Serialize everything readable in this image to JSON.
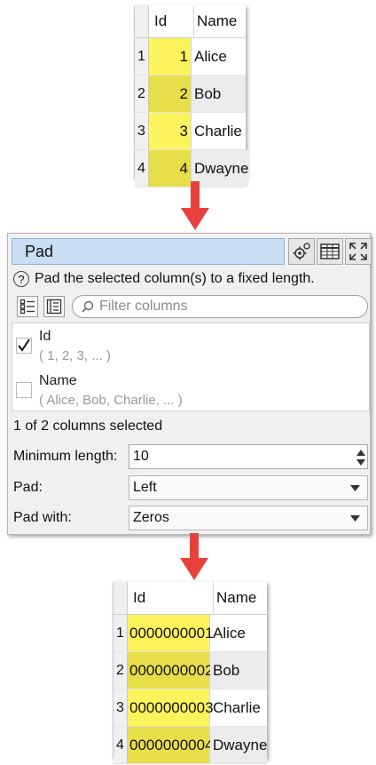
{
  "input_table": {
    "headers": {
      "id": "Id",
      "name": "Name"
    },
    "rows": [
      {
        "n": "1",
        "id": "1",
        "name": "Alice"
      },
      {
        "n": "2",
        "id": "2",
        "name": "Bob"
      },
      {
        "n": "3",
        "id": "3",
        "name": "Charlie"
      },
      {
        "n": "4",
        "id": "4",
        "name": "Dwayne"
      }
    ]
  },
  "panel": {
    "title": "Pad",
    "help_text": "Pad the selected column(s) to a fixed length.",
    "filter_placeholder": "Filter columns",
    "columns": [
      {
        "name": "Id",
        "values": "( 1, 2, 3, ... )",
        "checked": true
      },
      {
        "name": "Name",
        "values": "( Alice, Bob, Charlie, ... )",
        "checked": false
      }
    ],
    "selected_count": "1 of 2 columns selected",
    "min_length_label": "Minimum length:",
    "min_length_value": "10",
    "pad_label": "Pad:",
    "pad_value": "Left",
    "pad_with_label": "Pad with:",
    "pad_with_value": "Zeros",
    "icons": [
      "settings-gear-icon",
      "table-icon",
      "expand-icon"
    ]
  },
  "output_table": {
    "headers": {
      "id": "Id",
      "name": "Name"
    },
    "rows": [
      {
        "n": "1",
        "id": "0000000001",
        "name": "Alice"
      },
      {
        "n": "2",
        "id": "0000000002",
        "name": "Bob"
      },
      {
        "n": "3",
        "id": "0000000003",
        "name": "Charlie"
      },
      {
        "n": "4",
        "id": "0000000004",
        "name": "Dwayne"
      }
    ]
  },
  "colors": {
    "arrow": "#e8413c",
    "highlight": "#fdf35c",
    "highlight_alt": "#e8de4a",
    "title_bg": "#c9def5"
  }
}
